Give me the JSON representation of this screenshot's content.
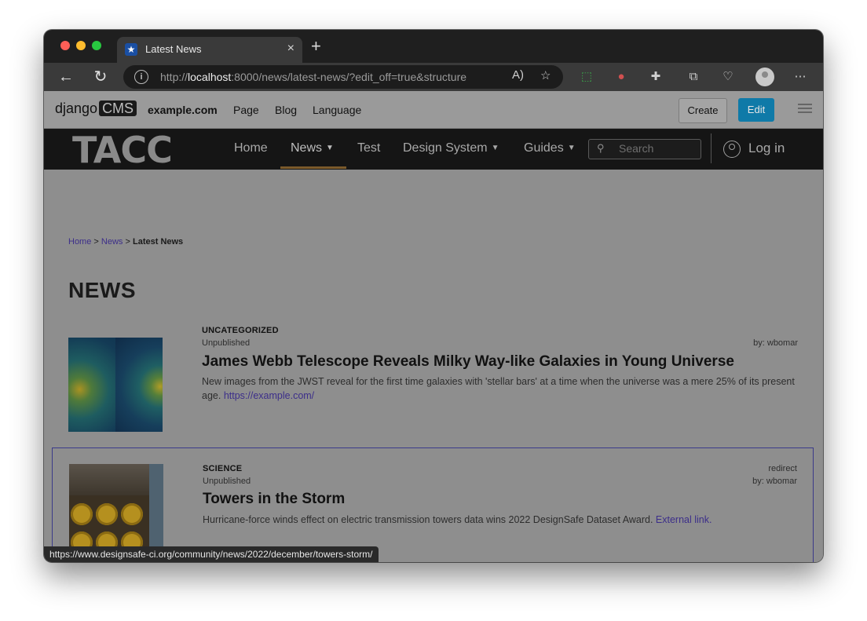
{
  "browser": {
    "tab_title": "Latest News",
    "tab_close": "×",
    "new_tab": "+",
    "url_scheme": "http://",
    "url_host": "localhost",
    "url_rest": ":8000/news/latest-news/?edit_off=true&structure",
    "status_link": "https://www.designsafe-ci.org/community/news/2022/december/towers-storm/"
  },
  "cms_toolbar": {
    "logo_django": "django",
    "logo_cms": "CMS",
    "site": "example.com",
    "menu": [
      "Page",
      "Blog",
      "Language"
    ],
    "create_label": "Create",
    "edit_label": "Edit"
  },
  "site_header": {
    "logo": "TACC",
    "nav": [
      {
        "label": "Home",
        "dropdown": false
      },
      {
        "label": "News",
        "dropdown": true,
        "active": true
      },
      {
        "label": "Test",
        "dropdown": false
      },
      {
        "label": "Design System",
        "dropdown": true
      },
      {
        "label": "Guides",
        "dropdown": true
      }
    ],
    "search_placeholder": "Search",
    "login_label": "Log in"
  },
  "breadcrumb": {
    "home": "Home",
    "sep1": ">",
    "news": "News",
    "sep2": ">",
    "current": "Latest News"
  },
  "page_title": "NEWS",
  "articles": [
    {
      "category": "UNCATEGORIZED",
      "status": "Unpublished",
      "author": "by: wbomar",
      "title": "James Webb Telescope Reveals Milky Way-like Galaxies in Young Universe",
      "description": "New images from the JWST reveal for the first time galaxies with 'stellar bars' at a time when the universe was a mere 25% of its present age.",
      "link_text": "https://example.com/"
    },
    {
      "category": "SCIENCE",
      "status": "Unpublished",
      "redirect": "redirect",
      "author": "by: wbomar",
      "title": "Towers in the Storm",
      "description": "Hurricane-force winds effect on electric transmission towers data wins 2022 DesignSafe Dataset Award.",
      "link_text": "External link."
    }
  ],
  "colors": {
    "link": "#3c2e8a",
    "edit_button": "#0f7aa8",
    "header_bg": "#151515",
    "nav_active_underline": "#7b5a2b",
    "selection_border": "#3b3a8a"
  }
}
